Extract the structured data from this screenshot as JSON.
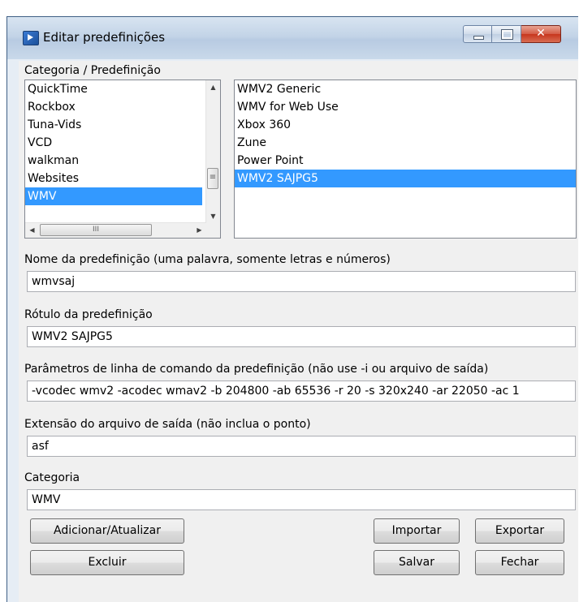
{
  "window": {
    "title": "Editar predefinições",
    "close_glyph": "✕"
  },
  "category_label": "Categoria / Predefinição",
  "categories": {
    "items": [
      "QuickTime",
      "Rockbox",
      "Tuna-Vids",
      "VCD",
      "walkman",
      "Websites",
      "WMV"
    ],
    "selected": "WMV",
    "scroll_up": "▲",
    "scroll_down": "▼",
    "scroll_left": "◀",
    "scroll_right": "▶",
    "thumb_grip": "III",
    "vthumb_grip": "≡"
  },
  "presets": {
    "items": [
      "WMV2 Generic",
      "WMV for Web Use",
      "Xbox 360",
      "Zune",
      "Power Point",
      "WMV2 SAJPG5"
    ],
    "selected": "WMV2 SAJPG5"
  },
  "fields": {
    "name_label": "Nome da predefinição (uma palavra, somente letras e números)",
    "name_value": "wmvsaj",
    "tag_label": "Rótulo da predefinição",
    "tag_value": "WMV2 SAJPG5",
    "params_label": "Parâmetros de linha de comando da predefinição (não use -i ou arquivo de saída)",
    "params_value": "-vcodec wmv2 -acodec wmav2 -b 204800 -ab 65536 -r 20 -s 320x240 -ar 22050 -ac 1",
    "ext_label": "Extensão do arquivo de saída (não inclua o ponto)",
    "ext_value": "asf",
    "category_label": "Categoria",
    "category_value": "WMV"
  },
  "buttons": {
    "add_update": "Adicionar/Atualizar",
    "delete": "Excluir",
    "import": "Importar",
    "export": "Exportar",
    "save": "Salvar",
    "close": "Fechar"
  },
  "colors": {
    "selection": "#3399ff",
    "window_frame": "#c3d4e7",
    "close_button": "#c7361d"
  }
}
